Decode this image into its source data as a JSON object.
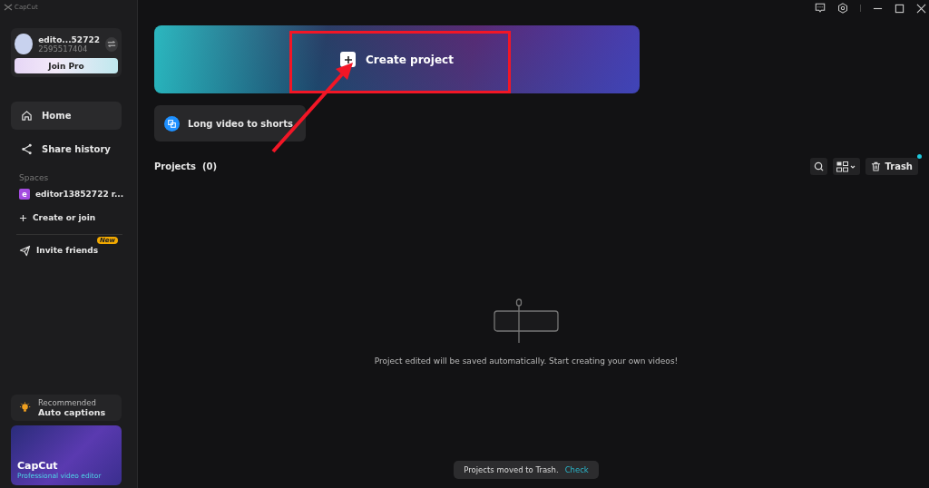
{
  "app": {
    "name": "CapCut"
  },
  "account": {
    "name": "edito...52722",
    "id": "2595517404",
    "upgrade_button": "Join Pro"
  },
  "nav": [
    {
      "label": "Home",
      "kind": "home",
      "selected": true
    },
    {
      "label": "Share history",
      "kind": "share",
      "selected": false
    }
  ],
  "spaces": {
    "heading": "Spaces",
    "items": [
      {
        "initial": "e",
        "label": "editor13852722 r..."
      }
    ],
    "create": "Create or join"
  },
  "invite": {
    "label": "Invite friends",
    "badge": "New"
  },
  "recommended": {
    "caption": "Recommended",
    "title": "Auto captions"
  },
  "promo": {
    "title": "CapCut",
    "subtitle": "Professional video editor"
  },
  "banner": {
    "label": "Create project"
  },
  "tools": [
    {
      "label": "Long video to shorts"
    }
  ],
  "projects": {
    "heading": "Projects",
    "count": "(0)",
    "trash": "Trash",
    "trash_notification": true,
    "empty_message": "Project edited will be saved automatically. Start creating your own videos!"
  },
  "toast": {
    "message": "Projects moved to Trash.",
    "action": "Check"
  }
}
